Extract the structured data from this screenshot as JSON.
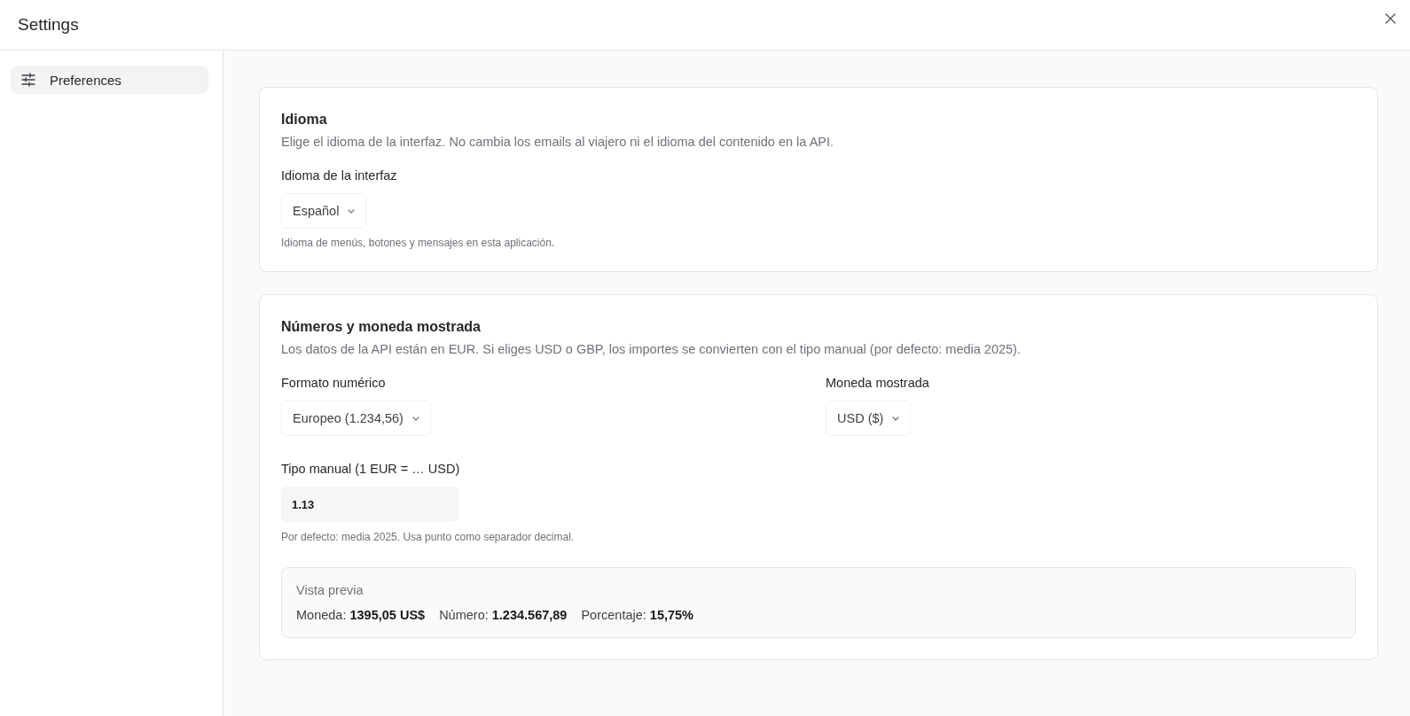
{
  "window": {
    "title": "Settings"
  },
  "sidebar": {
    "items": [
      {
        "label": "Preferences",
        "selected": true
      }
    ]
  },
  "sections": [
    {
      "title": "Idioma",
      "description": "Elige el idioma de la interfaz. No cambia los emails al viajero ni el idioma del contenido en la API.",
      "rows": [
        [
          {
            "kind": "select",
            "label": "Idioma de la interfaz",
            "value": "Español",
            "help": "Idioma de menús, botones y mensajes en esta aplicación."
          }
        ]
      ]
    },
    {
      "title": "Números y moneda mostrada",
      "description": "Los datos de la API están en EUR. Si eliges USD o GBP, los importes se convierten con el tipo manual (por defecto: media 2025).",
      "rows": [
        [
          {
            "kind": "select",
            "label": "Formato numérico",
            "value": "Europeo (1.234,56)"
          },
          {
            "kind": "select",
            "label": "Moneda mostrada",
            "value": "USD ($)"
          }
        ],
        [
          {
            "kind": "input",
            "label": "Tipo manual (1 EUR = … USD)",
            "value": "1.13",
            "help": "Por defecto: media 2025. Usa punto como separador decimal."
          }
        ]
      ],
      "preview": {
        "title": "Vista previa",
        "items": [
          "Moneda: **1395,05 US$**",
          "Número: **1.234.567,89**",
          "Porcentaje: **15,75%**"
        ]
      }
    }
  ]
}
